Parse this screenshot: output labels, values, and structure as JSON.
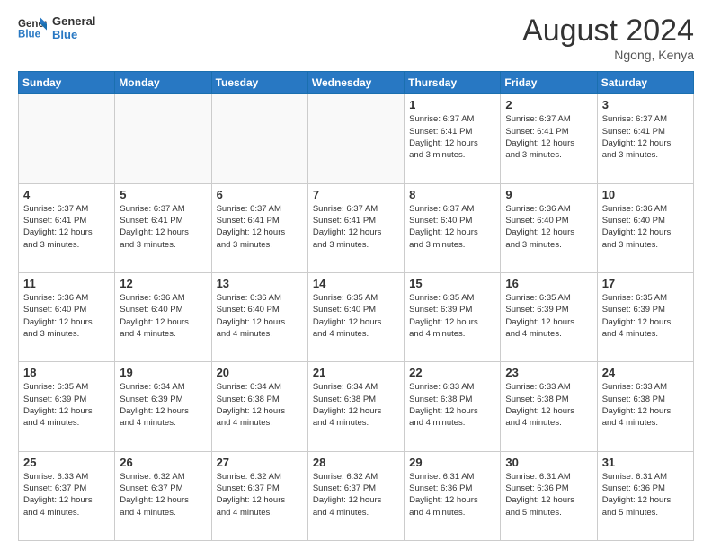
{
  "header": {
    "logo_line1": "General",
    "logo_line2": "Blue",
    "month_title": "August 2024",
    "location": "Ngong, Kenya"
  },
  "days_of_week": [
    "Sunday",
    "Monday",
    "Tuesday",
    "Wednesday",
    "Thursday",
    "Friday",
    "Saturday"
  ],
  "weeks": [
    [
      {
        "day": "",
        "info": ""
      },
      {
        "day": "",
        "info": ""
      },
      {
        "day": "",
        "info": ""
      },
      {
        "day": "",
        "info": ""
      },
      {
        "day": "1",
        "info": "Sunrise: 6:37 AM\nSunset: 6:41 PM\nDaylight: 12 hours\nand 3 minutes."
      },
      {
        "day": "2",
        "info": "Sunrise: 6:37 AM\nSunset: 6:41 PM\nDaylight: 12 hours\nand 3 minutes."
      },
      {
        "day": "3",
        "info": "Sunrise: 6:37 AM\nSunset: 6:41 PM\nDaylight: 12 hours\nand 3 minutes."
      }
    ],
    [
      {
        "day": "4",
        "info": "Sunrise: 6:37 AM\nSunset: 6:41 PM\nDaylight: 12 hours\nand 3 minutes."
      },
      {
        "day": "5",
        "info": "Sunrise: 6:37 AM\nSunset: 6:41 PM\nDaylight: 12 hours\nand 3 minutes."
      },
      {
        "day": "6",
        "info": "Sunrise: 6:37 AM\nSunset: 6:41 PM\nDaylight: 12 hours\nand 3 minutes."
      },
      {
        "day": "7",
        "info": "Sunrise: 6:37 AM\nSunset: 6:41 PM\nDaylight: 12 hours\nand 3 minutes."
      },
      {
        "day": "8",
        "info": "Sunrise: 6:37 AM\nSunset: 6:40 PM\nDaylight: 12 hours\nand 3 minutes."
      },
      {
        "day": "9",
        "info": "Sunrise: 6:36 AM\nSunset: 6:40 PM\nDaylight: 12 hours\nand 3 minutes."
      },
      {
        "day": "10",
        "info": "Sunrise: 6:36 AM\nSunset: 6:40 PM\nDaylight: 12 hours\nand 3 minutes."
      }
    ],
    [
      {
        "day": "11",
        "info": "Sunrise: 6:36 AM\nSunset: 6:40 PM\nDaylight: 12 hours\nand 3 minutes."
      },
      {
        "day": "12",
        "info": "Sunrise: 6:36 AM\nSunset: 6:40 PM\nDaylight: 12 hours\nand 4 minutes."
      },
      {
        "day": "13",
        "info": "Sunrise: 6:36 AM\nSunset: 6:40 PM\nDaylight: 12 hours\nand 4 minutes."
      },
      {
        "day": "14",
        "info": "Sunrise: 6:35 AM\nSunset: 6:40 PM\nDaylight: 12 hours\nand 4 minutes."
      },
      {
        "day": "15",
        "info": "Sunrise: 6:35 AM\nSunset: 6:39 PM\nDaylight: 12 hours\nand 4 minutes."
      },
      {
        "day": "16",
        "info": "Sunrise: 6:35 AM\nSunset: 6:39 PM\nDaylight: 12 hours\nand 4 minutes."
      },
      {
        "day": "17",
        "info": "Sunrise: 6:35 AM\nSunset: 6:39 PM\nDaylight: 12 hours\nand 4 minutes."
      }
    ],
    [
      {
        "day": "18",
        "info": "Sunrise: 6:35 AM\nSunset: 6:39 PM\nDaylight: 12 hours\nand 4 minutes."
      },
      {
        "day": "19",
        "info": "Sunrise: 6:34 AM\nSunset: 6:39 PM\nDaylight: 12 hours\nand 4 minutes."
      },
      {
        "day": "20",
        "info": "Sunrise: 6:34 AM\nSunset: 6:38 PM\nDaylight: 12 hours\nand 4 minutes."
      },
      {
        "day": "21",
        "info": "Sunrise: 6:34 AM\nSunset: 6:38 PM\nDaylight: 12 hours\nand 4 minutes."
      },
      {
        "day": "22",
        "info": "Sunrise: 6:33 AM\nSunset: 6:38 PM\nDaylight: 12 hours\nand 4 minutes."
      },
      {
        "day": "23",
        "info": "Sunrise: 6:33 AM\nSunset: 6:38 PM\nDaylight: 12 hours\nand 4 minutes."
      },
      {
        "day": "24",
        "info": "Sunrise: 6:33 AM\nSunset: 6:38 PM\nDaylight: 12 hours\nand 4 minutes."
      }
    ],
    [
      {
        "day": "25",
        "info": "Sunrise: 6:33 AM\nSunset: 6:37 PM\nDaylight: 12 hours\nand 4 minutes."
      },
      {
        "day": "26",
        "info": "Sunrise: 6:32 AM\nSunset: 6:37 PM\nDaylight: 12 hours\nand 4 minutes."
      },
      {
        "day": "27",
        "info": "Sunrise: 6:32 AM\nSunset: 6:37 PM\nDaylight: 12 hours\nand 4 minutes."
      },
      {
        "day": "28",
        "info": "Sunrise: 6:32 AM\nSunset: 6:37 PM\nDaylight: 12 hours\nand 4 minutes."
      },
      {
        "day": "29",
        "info": "Sunrise: 6:31 AM\nSunset: 6:36 PM\nDaylight: 12 hours\nand 4 minutes."
      },
      {
        "day": "30",
        "info": "Sunrise: 6:31 AM\nSunset: 6:36 PM\nDaylight: 12 hours\nand 5 minutes."
      },
      {
        "day": "31",
        "info": "Sunrise: 6:31 AM\nSunset: 6:36 PM\nDaylight: 12 hours\nand 5 minutes."
      }
    ]
  ]
}
